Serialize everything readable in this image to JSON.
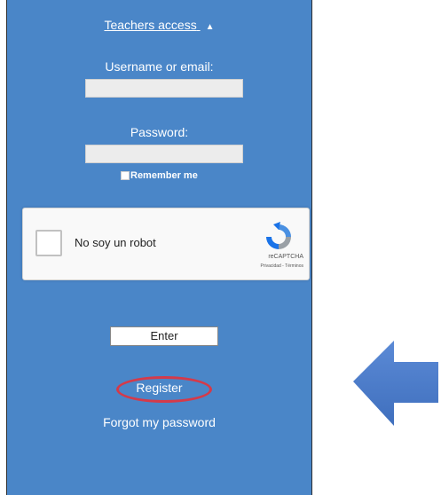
{
  "teachers_access": {
    "label": "Teachers access",
    "caret": "▲"
  },
  "login": {
    "username_label": "Username or email:",
    "username_value": "",
    "password_label": "Password:",
    "password_value": "",
    "remember_label": "Remember me"
  },
  "captcha": {
    "label": "No soy un robot",
    "brand": "reCAPTCHA",
    "terms": "Privacidad - Términos",
    "icon": "recaptcha-logo"
  },
  "enter_button": "Enter",
  "register_link": "Register",
  "forgot_link": "Forgot my password",
  "colors": {
    "panel": "#4a86c8",
    "highlight_ring": "#d43a4a",
    "arrow": "#4a78c4"
  }
}
